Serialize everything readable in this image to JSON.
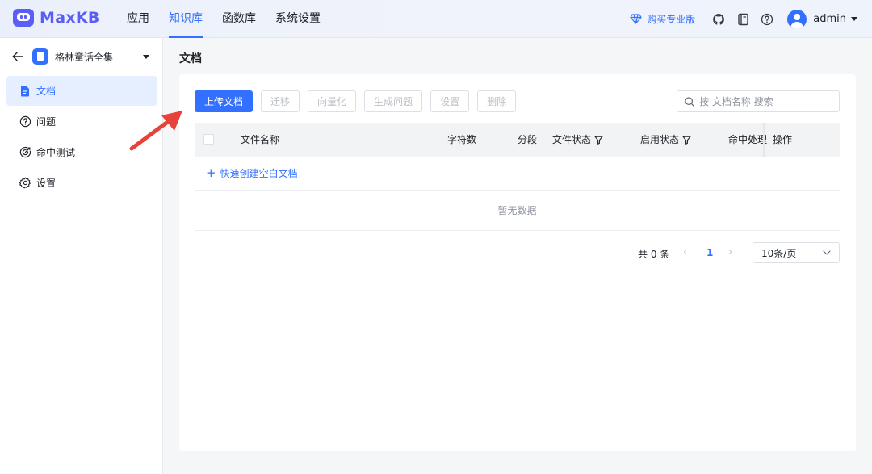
{
  "header": {
    "logo_text": "MaxKB",
    "nav": [
      {
        "label": "应用",
        "active": false
      },
      {
        "label": "知识库",
        "active": true
      },
      {
        "label": "函数库",
        "active": false
      },
      {
        "label": "系统设置",
        "active": false
      }
    ],
    "pro_label": "购买专业版",
    "user_name": "admin"
  },
  "sidebar": {
    "kb_name": "格林童话全集",
    "items": [
      {
        "label": "文档",
        "icon": "document-icon",
        "active": true
      },
      {
        "label": "问题",
        "icon": "question-icon",
        "active": false
      },
      {
        "label": "命中测试",
        "icon": "target-icon",
        "active": false
      },
      {
        "label": "设置",
        "icon": "gear-icon",
        "active": false
      }
    ]
  },
  "main": {
    "title": "文档",
    "toolbar": {
      "upload": "上传文档",
      "migrate": "迁移",
      "vectorize": "向量化",
      "generate": "生成问题",
      "settings": "设置",
      "delete": "删除"
    },
    "search_placeholder": "按 文档名称 搜索",
    "columns": {
      "name": "文件名称",
      "chars": "字符数",
      "segments": "分段",
      "file_status": "文件状态",
      "enable_status": "启用状态",
      "hit_handling": "命中处理",
      "actions": "操作"
    },
    "quick_create": "快速创建空白文档",
    "empty_text": "暂无数据",
    "pagination": {
      "total": "共 0 条",
      "current_page": "1",
      "page_size": "10条/页"
    }
  },
  "colors": {
    "primary": "#3370ff",
    "logo": "#5b5ef5",
    "annotation_arrow": "#e8433b"
  }
}
